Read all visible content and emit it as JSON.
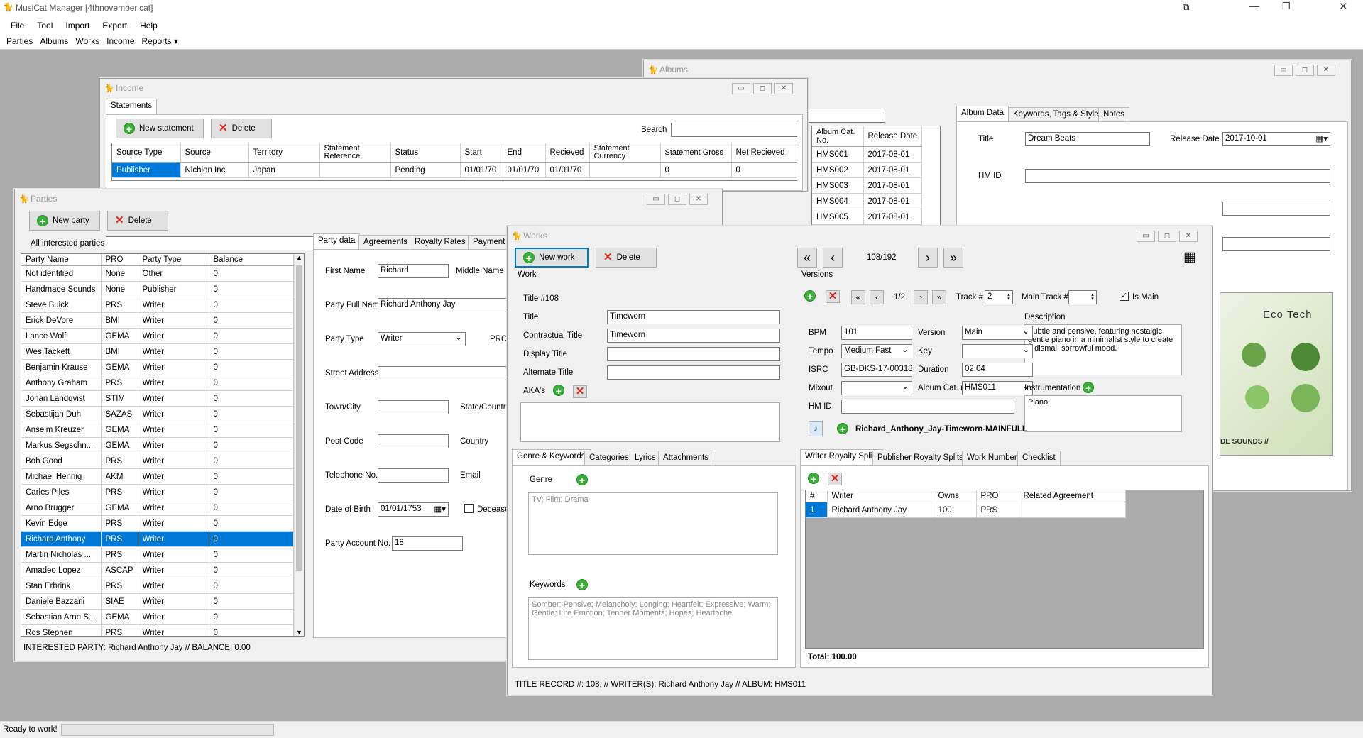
{
  "app": {
    "title": "MusiCat Manager [4thnovember.cat]"
  },
  "menu": [
    "File",
    "Tool",
    "Import",
    "Export",
    "Help"
  ],
  "toolbar": [
    "Parties",
    "Albums",
    "Works",
    "Income",
    "Reports ▾"
  ],
  "status": {
    "text": "Ready to work!"
  },
  "albums": {
    "title": "Albums",
    "tabs": [
      "Album Data",
      "Keywords, Tags & Styles",
      "Notes"
    ],
    "grid_headers": [
      "Album Cat. No.",
      "Release Date"
    ],
    "rows": [
      [
        "HMS001",
        "2017-08-01"
      ],
      [
        "HMS002",
        "2017-08-01"
      ],
      [
        "HMS003",
        "2017-08-01"
      ],
      [
        "HMS004",
        "2017-08-01"
      ],
      [
        "HMS005",
        "2017-08-01"
      ]
    ],
    "title_label": "Title",
    "title_value": "Dream Beats",
    "release_label": "Release Date",
    "release_value": "2017-10-01",
    "hmid_label": "HM ID",
    "cover_text": "Eco Tech",
    "cover_sub": "DE SOUNDS //"
  },
  "income": {
    "title": "Income",
    "tab": "Statements",
    "new_btn": "New statement",
    "del_btn": "Delete",
    "search_label": "Search",
    "headers": [
      "Source Type",
      "Source",
      "Territory",
      "Statement Reference",
      "Status",
      "Start",
      "End",
      "Recieved",
      "Statement Currency",
      "Statement Gross",
      "Net Recieved"
    ],
    "row": [
      "Publisher",
      "Nichion Inc.",
      "Japan",
      "",
      "Pending",
      "01/01/70",
      "01/01/70",
      "01/01/70",
      "",
      "0",
      "0"
    ]
  },
  "parties": {
    "title": "Parties",
    "new_btn": "New party",
    "del_btn": "Delete",
    "filter_label": "All interested parties",
    "headers": [
      "Party Name",
      "PRO",
      "Party Type",
      "Balance"
    ],
    "rows": [
      [
        "Not identified",
        "None",
        "Other",
        "0"
      ],
      [
        "Handmade Sounds",
        "None",
        "Publisher",
        "0"
      ],
      [
        "Steve Buick",
        "PRS",
        "Writer",
        "0"
      ],
      [
        "Erick DeVore",
        "BMI",
        "Writer",
        "0"
      ],
      [
        "Lance Wolf",
        "GEMA",
        "Writer",
        "0"
      ],
      [
        "Wes Tackett",
        "BMI",
        "Writer",
        "0"
      ],
      [
        "Benjamin Krause",
        "GEMA",
        "Writer",
        "0"
      ],
      [
        "Anthony Graham",
        "PRS",
        "Writer",
        "0"
      ],
      [
        "Johan Landqvist",
        "STIM",
        "Writer",
        "0"
      ],
      [
        "Sebastijan Duh",
        "SAZAS",
        "Writer",
        "0"
      ],
      [
        "Anselm Kreuzer",
        "GEMA",
        "Writer",
        "0"
      ],
      [
        "Markus Segschn...",
        "GEMA",
        "Writer",
        "0"
      ],
      [
        "Bob Good",
        "PRS",
        "Writer",
        "0"
      ],
      [
        "Michael Hennig",
        "AKM",
        "Writer",
        "0"
      ],
      [
        "Carles Piles",
        "PRS",
        "Writer",
        "0"
      ],
      [
        "Arno Brugger",
        "GEMA",
        "Writer",
        "0"
      ],
      [
        "Kevin Edge",
        "PRS",
        "Writer",
        "0"
      ],
      [
        "Richard Anthony",
        "PRS",
        "Writer",
        "0"
      ],
      [
        "Martin Nicholas ...",
        "PRS",
        "Writer",
        "0"
      ],
      [
        "Amadeo Lopez",
        "ASCAP",
        "Writer",
        "0"
      ],
      [
        "Stan Erbrink",
        "PRS",
        "Writer",
        "0"
      ],
      [
        "Daniele Bazzani",
        "SIAE",
        "Writer",
        "0"
      ],
      [
        "Sebastian Arno S...",
        "GEMA",
        "Writer",
        "0"
      ],
      [
        "Ros Stephen",
        "PRS",
        "Writer",
        "0"
      ]
    ],
    "selected_index": 17,
    "tabs": [
      "Party data",
      "Agreements",
      "Royalty Rates",
      "Payment info"
    ],
    "fields": {
      "first_name_l": "First Name",
      "first_name": "Richard",
      "middle_l": "Middle Name",
      "full_l": "Party Full Name",
      "full": "Richard Anthony Jay",
      "type_l": "Party Type",
      "type": "Writer",
      "pro_l": "PRO",
      "street_l": "Street Address",
      "town_l": "Town/City",
      "state_l": "State/Country",
      "post_l": "Post Code",
      "country_l": "Country",
      "tel_l": "Telephone No.",
      "email_l": "Email",
      "dob_l": "Date of Birth",
      "dob": "01/01/1753",
      "deceased_l": "Deceased",
      "acct_l": "Party Account No.",
      "acct": "18"
    },
    "footer": "INTERESTED PARTY: Richard Anthony Jay // BALANCE: 0.00"
  },
  "works": {
    "title": "Works",
    "new_btn": "New work",
    "del_btn": "Delete",
    "counter": "108/192",
    "work_group": "Work",
    "versions_group": "Versions",
    "title_no": "Title #108",
    "f": {
      "title_l": "Title",
      "title": "Timeworn",
      "ctitle_l": "Contractual Title",
      "ctitle": "Timeworn",
      "dtitle_l": "Display Title",
      "atitle_l": "Alternate Title",
      "aka_l": "AKA's"
    },
    "ver": {
      "counter": "1/2",
      "track_l": "Track #",
      "track": "2",
      "main_track_l": "Main Track #",
      "is_main": "Is Main",
      "desc_l": "Description",
      "desc": "Subtle and pensive, featuring nostalgic gentle piano in a minimalist style to create a dismal, sorrowful mood.",
      "bpm_l": "BPM",
      "bpm": "101",
      "version_l": "Version",
      "version": "Main",
      "tempo_l": "Tempo",
      "tempo": "Medium Fast",
      "key_l": "Key",
      "isrc_l": "ISRC",
      "isrc": "GB-DKS-17-00318",
      "dur_l": "Duration",
      "dur": "02:04",
      "mix_l": "Mixout",
      "album_l": "Album Cat. no",
      "album": "HMS011",
      "instr_l": "Instrumentation",
      "instr": "Piano",
      "hmid_l": "HM ID",
      "file": "Richard_Anthony_Jay-Timeworn-MAINFULL"
    },
    "ltabs": [
      "Genre & Keywords",
      "Categories",
      "Lyrics",
      "Attachments"
    ],
    "genre_l": "Genre",
    "genre": "TV; Film; Drama",
    "kw_l": "Keywords",
    "kw": "Somber; Pensive; Melancholy; Longing; Heartfelt; Expressive; Warm; Gentle; Life Emotion; Tender Moments; Hopes; Heartache",
    "rtabs": [
      "Writer Royalty Splits",
      "Publisher Royalty Splits",
      "Work Numbers",
      "Checklist"
    ],
    "split_headers": [
      "#",
      "Writer",
      "Owns",
      "PRO",
      "Related Agreement"
    ],
    "split_row": [
      "1",
      "Richard Anthony Jay",
      "100",
      "PRS",
      ""
    ],
    "total": "Total: 100.00",
    "footer": "TITLE RECORD #: 108, // WRITER(S): Richard Anthony Jay // ALBUM: HMS011"
  }
}
